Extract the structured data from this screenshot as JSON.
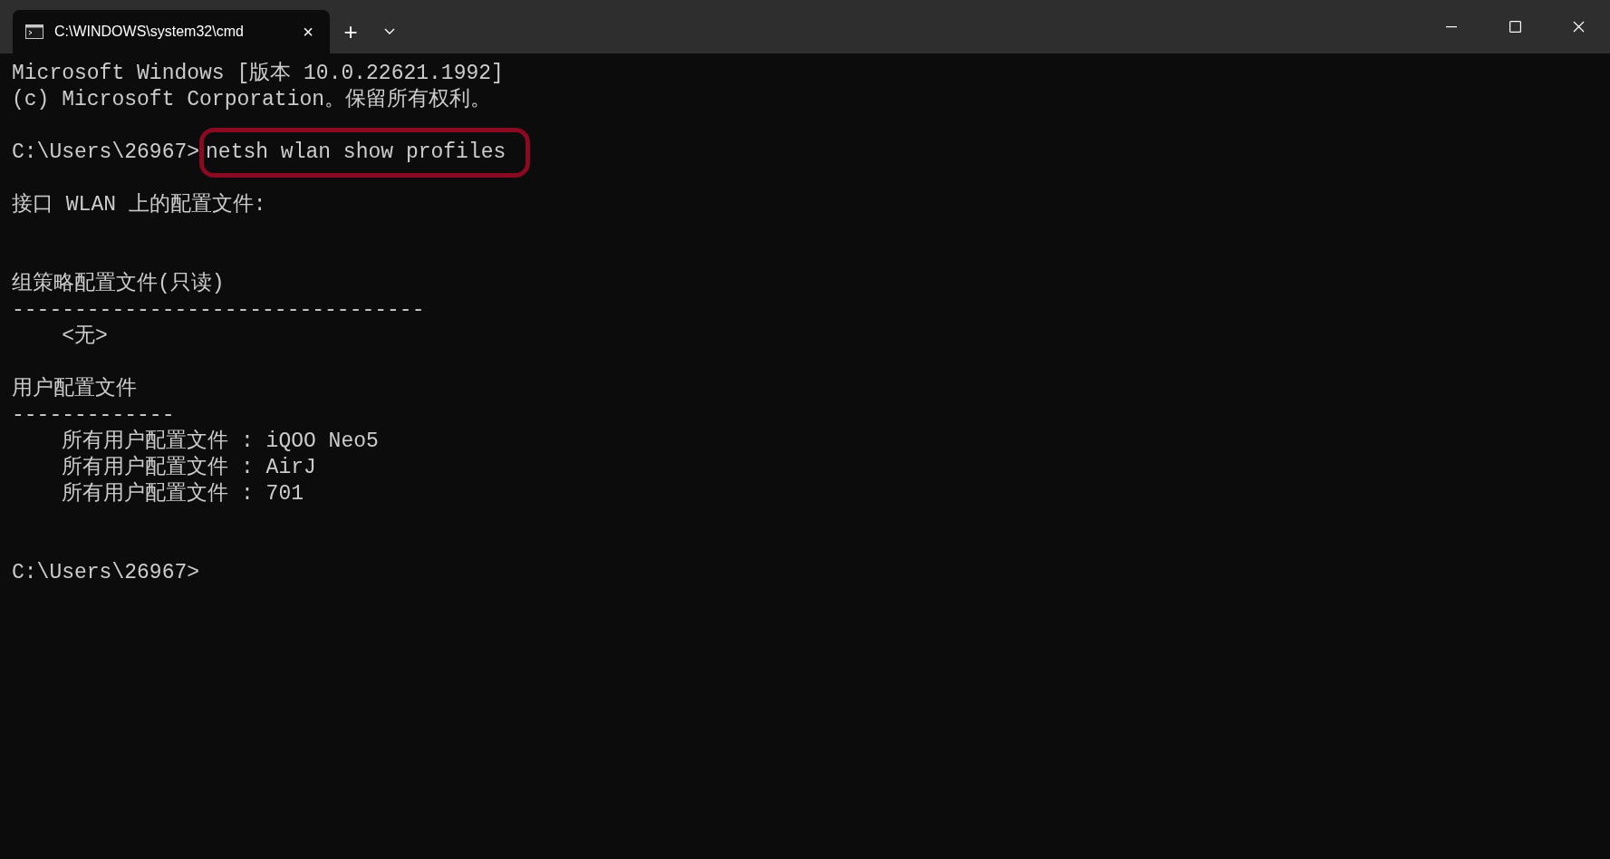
{
  "tab": {
    "title": "C:\\WINDOWS\\system32\\cmd",
    "selected": true,
    "close": "×"
  },
  "new_tab": "+",
  "lines": [
    {
      "kind": "output",
      "text": "Microsoft Windows [版本 10.0.22621.1992]"
    },
    {
      "kind": "output",
      "text": "(c) Microsoft Corporation。保留所有权利。"
    },
    {
      "kind": "blank"
    },
    {
      "kind": "prompt",
      "prompt": "C:\\Users\\26967>",
      "command": "netsh wlan show profiles",
      "highlighted": true
    },
    {
      "kind": "blank"
    },
    {
      "kind": "output",
      "text": "接口 WLAN 上的配置文件:"
    },
    {
      "kind": "blank"
    },
    {
      "kind": "blank"
    },
    {
      "kind": "output",
      "text": "组策略配置文件(只读)"
    },
    {
      "kind": "output",
      "text": "---------------------------------"
    },
    {
      "kind": "output",
      "text": "<无>",
      "indented": true
    },
    {
      "kind": "blank"
    },
    {
      "kind": "output",
      "text": "用户配置文件"
    },
    {
      "kind": "output",
      "text": "-------------"
    },
    {
      "kind": "output",
      "text": "所有用户配置文件 : iQOO Neo5",
      "indented": true
    },
    {
      "kind": "output",
      "text": "所有用户配置文件 : AirJ",
      "indented": true
    },
    {
      "kind": "output",
      "text": "所有用户配置文件 : 701",
      "indented": true
    },
    {
      "kind": "blank"
    },
    {
      "kind": "blank"
    },
    {
      "kind": "prompt",
      "prompt": "C:\\Users\\26967>"
    }
  ]
}
